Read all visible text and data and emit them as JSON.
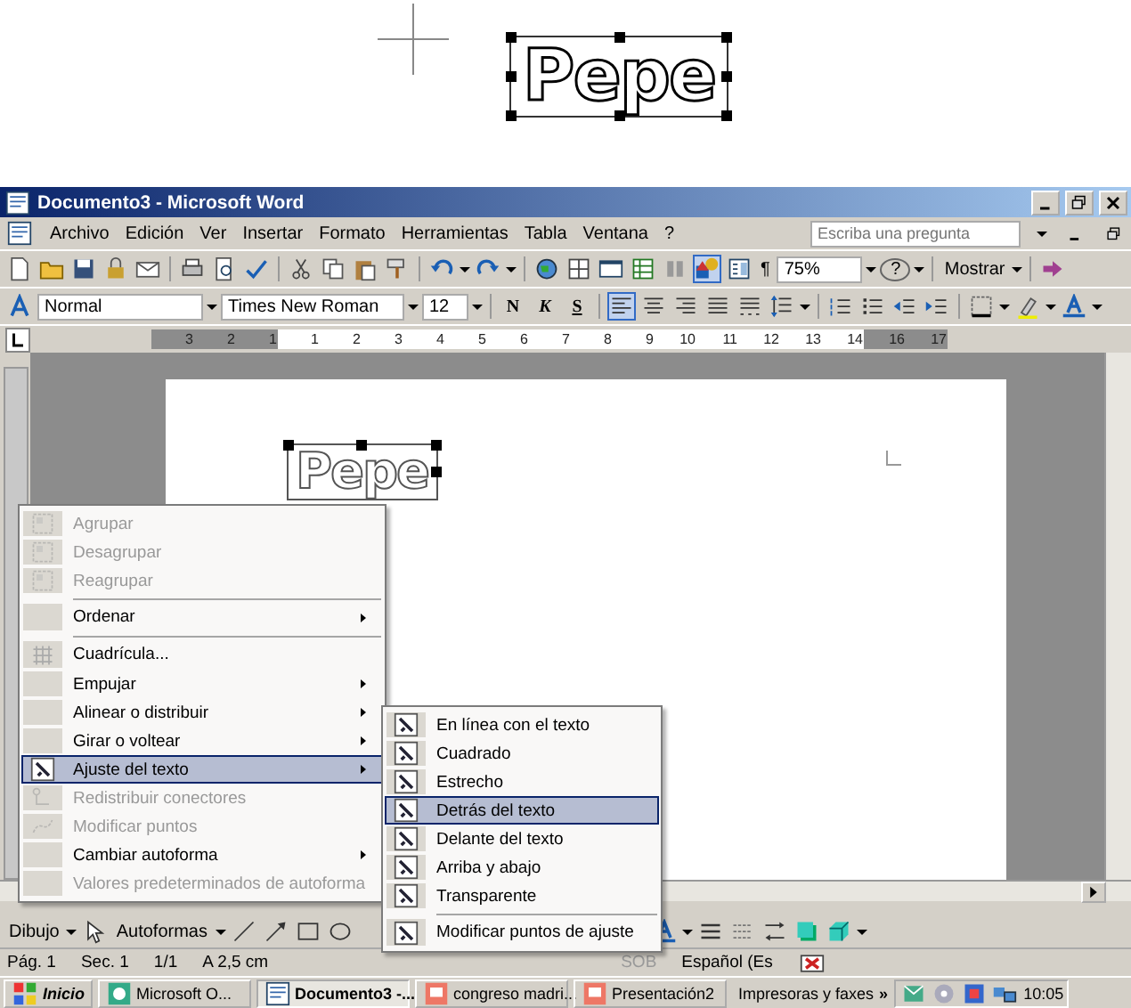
{
  "top_wordart": {
    "text": "Pepe"
  },
  "window": {
    "title": "Documento3 - Microsoft Word"
  },
  "menubar": {
    "items": [
      "Archivo",
      "Edición",
      "Ver",
      "Insertar",
      "Formato",
      "Herramientas",
      "Tabla",
      "Ventana",
      "?"
    ],
    "help_placeholder": "Escriba una pregunta"
  },
  "standard_toolbar": {
    "pilcrow": "¶",
    "zoom": "75%",
    "help": "?",
    "show": "Mostrar",
    "drawing_pressed": true
  },
  "formatting_toolbar": {
    "style": "Normal",
    "font": "Times New Roman",
    "size": "12",
    "style_buttons": [
      "N",
      "K",
      "S"
    ],
    "align_left_pressed": true
  },
  "ruler": {
    "marks": [
      {
        "label": "3",
        "margin": true
      },
      {
        "label": "2",
        "margin": true
      },
      {
        "label": "1",
        "margin": true
      },
      {
        "label": "1",
        "margin": false
      },
      {
        "label": "2",
        "margin": false
      },
      {
        "label": "3",
        "margin": false
      },
      {
        "label": "4",
        "margin": false
      },
      {
        "label": "5",
        "margin": false
      },
      {
        "label": "6",
        "margin": false
      },
      {
        "label": "7",
        "margin": false
      },
      {
        "label": "8",
        "margin": false
      },
      {
        "label": "9",
        "margin": false
      },
      {
        "label": "10",
        "margin": false
      },
      {
        "label": "11",
        "margin": false
      },
      {
        "label": "12",
        "margin": false
      },
      {
        "label": "13",
        "margin": false
      },
      {
        "label": "14",
        "margin": false
      },
      {
        "label": "16",
        "margin": true
      },
      {
        "label": "17",
        "margin": true
      }
    ]
  },
  "document": {
    "wordart_text": "Pepe"
  },
  "context_menu": {
    "items": [
      {
        "label": "Agrupar",
        "disabled": true,
        "has_icon": true,
        "submenu": false,
        "separator_before": false,
        "selected": false
      },
      {
        "label": "Desagrupar",
        "disabled": true,
        "has_icon": true,
        "submenu": false,
        "separator_before": false,
        "selected": false
      },
      {
        "label": "Reagrupar",
        "disabled": true,
        "has_icon": true,
        "submenu": false,
        "separator_before": false,
        "selected": false
      },
      {
        "label": "Ordenar",
        "disabled": false,
        "has_icon": false,
        "submenu": true,
        "separator_before": true,
        "selected": false
      },
      {
        "label": "Cuadrícula...",
        "disabled": false,
        "has_icon": true,
        "submenu": false,
        "separator_before": true,
        "selected": false
      },
      {
        "label": "Empujar",
        "disabled": false,
        "has_icon": false,
        "submenu": true,
        "separator_before": false,
        "selected": false
      },
      {
        "label": "Alinear o distribuir",
        "disabled": false,
        "has_icon": false,
        "submenu": true,
        "separator_before": false,
        "selected": false
      },
      {
        "label": "Girar o voltear",
        "disabled": false,
        "has_icon": false,
        "submenu": true,
        "separator_before": false,
        "selected": false
      },
      {
        "label": "Ajuste del texto",
        "disabled": false,
        "has_icon": true,
        "submenu": true,
        "separator_before": false,
        "selected": true
      },
      {
        "label": "Redistribuir conectores",
        "disabled": true,
        "has_icon": true,
        "submenu": false,
        "separator_before": false,
        "selected": false
      },
      {
        "label": "Modificar puntos",
        "disabled": true,
        "has_icon": true,
        "submenu": false,
        "separator_before": false,
        "selected": false
      },
      {
        "label": "Cambiar autoforma",
        "disabled": false,
        "has_icon": false,
        "submenu": true,
        "separator_before": false,
        "selected": false
      },
      {
        "label": "Valores predeterminados de autoforma",
        "disabled": true,
        "has_icon": false,
        "submenu": false,
        "separator_before": false,
        "selected": false
      }
    ]
  },
  "wrap_submenu": {
    "items": [
      {
        "label": "En línea con el texto",
        "separator_before": false,
        "selected": false
      },
      {
        "label": "Cuadrado",
        "separator_before": false,
        "selected": false
      },
      {
        "label": "Estrecho",
        "separator_before": false,
        "selected": false
      },
      {
        "label": "Detrás del texto",
        "separator_before": false,
        "selected": true
      },
      {
        "label": "Delante del texto",
        "separator_before": false,
        "selected": false
      },
      {
        "label": "Arriba y abajo",
        "separator_before": false,
        "selected": false
      },
      {
        "label": "Transparente",
        "separator_before": false,
        "selected": false
      },
      {
        "label": "Modificar puntos de ajuste",
        "separator_before": true,
        "selected": false
      }
    ]
  },
  "drawing_toolbar": {
    "draw": "Dibujo",
    "autoshapes": "Autoformas"
  },
  "status_bar": {
    "left": [
      {
        "label": "Pág. 1",
        "disabled": false
      },
      {
        "label": "Sec. 1",
        "disabled": false
      },
      {
        "label": "1/1",
        "disabled": false
      },
      {
        "label": "A 2,5 cm",
        "disabled": false
      }
    ],
    "right": [
      {
        "label": "SOB",
        "disabled": true
      },
      {
        "label": "Español (Es",
        "disabled": false
      }
    ]
  },
  "taskbar": {
    "start": "Inicio",
    "items": [
      {
        "label": "Microsoft O...",
        "selected": false
      },
      {
        "label": "Documento3 -...",
        "selected": true
      },
      {
        "label": "congreso madri...",
        "selected": false
      },
      {
        "label": "Presentación2",
        "selected": false
      }
    ],
    "tray_label": "Impresoras y faxes",
    "chevron": "»",
    "clock": "10:05"
  }
}
